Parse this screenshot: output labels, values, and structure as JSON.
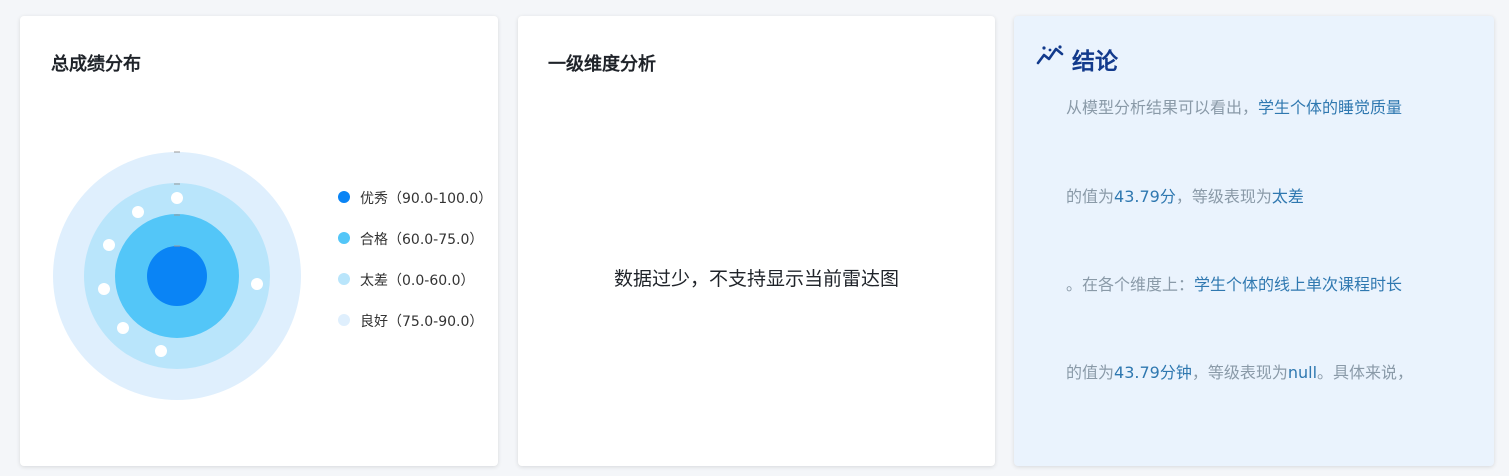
{
  "total_card": {
    "title": "总成绩分布",
    "legend": [
      {
        "label": "优秀（90.0-100.0）",
        "color": "#0a84f5"
      },
      {
        "label": "合格（60.0-75.0）",
        "color": "#53c6f8"
      },
      {
        "label": "太差（0.0-60.0）",
        "color": "#b9e5fb"
      },
      {
        "label": "良好（75.0-90.0）",
        "color": "#dfeffd"
      }
    ]
  },
  "dimension_card": {
    "title": "一级维度分析",
    "empty_message": "数据过少，不支持显示当前雷达图"
  },
  "conclusion_card": {
    "title": "结论",
    "icon": "trend-chart-icon",
    "lines": [
      [
        {
          "text": "从模型分析结果可以看出，",
          "hl": false
        },
        {
          "text": "学生个体的睡觉质量",
          "hl": true
        }
      ],
      [
        {
          "text": "的值为",
          "hl": false
        },
        {
          "text": "43.79分",
          "hl": true
        },
        {
          "text": "，等级表现为",
          "hl": false
        },
        {
          "text": "太差",
          "hl": true
        }
      ],
      [
        {
          "text": "。在各个维度上：",
          "hl": false
        },
        {
          "text": "学生个体的线上单次课程时长",
          "hl": true
        }
      ],
      [
        {
          "text": "的值为",
          "hl": false
        },
        {
          "text": "43.79分钟",
          "hl": true
        },
        {
          "text": "，等级表现为",
          "hl": false
        },
        {
          "text": "null",
          "hl": true
        },
        {
          "text": "。具体来说，",
          "hl": false
        }
      ]
    ]
  }
}
